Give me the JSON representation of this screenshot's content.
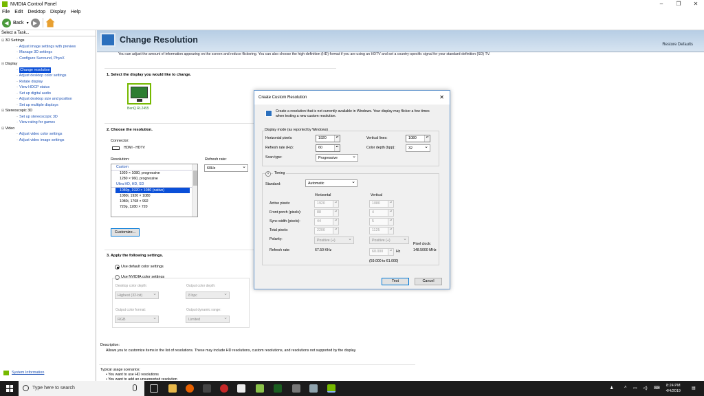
{
  "window": {
    "title": "NVIDIA Control Panel",
    "min": "–",
    "max": "❐",
    "close": "✕"
  },
  "menu": [
    "File",
    "Edit",
    "Desktop",
    "Display",
    "Help"
  ],
  "toolbar": {
    "back": "Back"
  },
  "sidebar": {
    "header": "Select a Task...",
    "tree": [
      {
        "type": "cat",
        "label": "3D Settings"
      },
      {
        "type": "item",
        "label": "Adjust image settings with preview"
      },
      {
        "type": "item",
        "label": "Manage 3D settings"
      },
      {
        "type": "item",
        "label": "Configure Surround, PhysX"
      },
      {
        "type": "cat",
        "label": "Display"
      },
      {
        "type": "item",
        "label": "Change resolution",
        "selected": true
      },
      {
        "type": "item",
        "label": "Adjust desktop color settings"
      },
      {
        "type": "item",
        "label": "Rotate display"
      },
      {
        "type": "item",
        "label": "View HDCP status"
      },
      {
        "type": "item",
        "label": "Set up digital audio"
      },
      {
        "type": "item",
        "label": "Adjust desktop size and position"
      },
      {
        "type": "item",
        "label": "Set up multiple displays"
      },
      {
        "type": "cat",
        "label": "Stereoscopic 3D"
      },
      {
        "type": "item",
        "label": "Set up stereoscopic 3D"
      },
      {
        "type": "item",
        "label": "View rating for games"
      },
      {
        "type": "cat",
        "label": "Video"
      },
      {
        "type": "item",
        "label": "Adjust video color settings"
      },
      {
        "type": "item",
        "label": "Adjust video image settings"
      }
    ],
    "system_info": "System Information"
  },
  "page": {
    "title": "Change Resolution",
    "restore": "Restore Defaults",
    "intro": "You can adjust the amount of information appearing on the screen and reduce flickering. You can also choose the high-definition (HD) format if you are using an HDTV and set a country-specific signal for your standard-definition (SD) TV.",
    "step1": "1. Select the display you would like to change.",
    "display_name": "BenQ RL2455",
    "step2": "2. Choose the resolution.",
    "connector_label": "Connector:",
    "connector_value": "HDMI - HDTV",
    "resolution_label": "Resolution:",
    "refresh_label": "Refresh rate:",
    "refresh_value": "60Hz",
    "res_list": [
      {
        "type": "grp",
        "label": "Custom"
      },
      {
        "type": "opt",
        "label": "1920 × 1080, progressive"
      },
      {
        "type": "opt",
        "label": "1280 × 960, progressive"
      },
      {
        "type": "grp",
        "label": "Ultra HD, HD, SD"
      },
      {
        "type": "hi",
        "label": "1080p, 1920 × 1080 (native)"
      },
      {
        "type": "opt",
        "label": "1080i, 1920 × 1080"
      },
      {
        "type": "opt",
        "label": "1080i, 1768 × 992"
      },
      {
        "type": "opt",
        "label": "720p, 1280 × 720"
      }
    ],
    "customize": "Customize...",
    "step3": "3. Apply the following settings.",
    "default_color": "Use default color settings",
    "nvidia_color": "Use NVIDIA color settings",
    "desktop_depth_label": "Desktop color depth:",
    "desktop_depth_value": "Highest (32-bit)",
    "output_depth_label": "Output color depth:",
    "output_depth_value": "8 bpc",
    "output_format_label": "Output color format:",
    "output_format_value": "RGB",
    "output_range_label": "Output dynamic range:",
    "output_range_value": "Limited",
    "desc_label": "Description:",
    "desc_text": "Allows you to customize items in the list of resolutions. These may include HD resolutions, custom resolutions, and resolutions not supported by the display.",
    "usage_label": "Typical usage scenarios:",
    "usage_1": "• You want to use HD resolutions",
    "usage_2": "• You want to add an unsupported resolution"
  },
  "dialog": {
    "title": "Create Custom Resolution",
    "close": "✕",
    "info": "Create a resolution that is not currently available in Windows. Your display may flicker a few times when testing a new custom resolution.",
    "display_mode": "Display mode (as reported by Windows)",
    "h_pixels_label": "Horizontal pixels:",
    "h_pixels": "1920",
    "v_lines_label": "Vertical lines:",
    "v_lines": "1080",
    "refresh_label": "Refresh rate (Hz):",
    "refresh": "60",
    "depth_label": "Color depth (bpp):",
    "depth": "32",
    "scan_label": "Scan type:",
    "scan": "Progressive",
    "timing": "Timing",
    "standard_label": "Standard:",
    "standard": "Automatic",
    "col_h": "Horizontal",
    "col_v": "Vertical",
    "rows": [
      {
        "label": "Active pixels:",
        "h": "1920",
        "v": "1080"
      },
      {
        "label": "Front porch (pixels):",
        "h": "88",
        "v": "4"
      },
      {
        "label": "Sync width (pixels):",
        "h": "44",
        "v": "5"
      },
      {
        "label": "Total pixels:",
        "h": "2200",
        "v": "1125"
      }
    ],
    "polarity_label": "Polarity:",
    "polarity_h": "Positive (+)",
    "polarity_v": "Positive (+)",
    "refresh_rate_label": "Refresh rate:",
    "refresh_khz": "67.50 KHz",
    "refresh_hz": "60.000",
    "hz_unit": "Hz",
    "refresh_range": "(59.000 to 61.000)",
    "pixel_clock_label": "Pixel clock:",
    "pixel_clock": "148.5000 MHz",
    "test": "Test",
    "cancel": "Cancel"
  },
  "taskbar": {
    "search": "Type here to search",
    "time": "8:24 PM",
    "date": "4/4/2019"
  }
}
